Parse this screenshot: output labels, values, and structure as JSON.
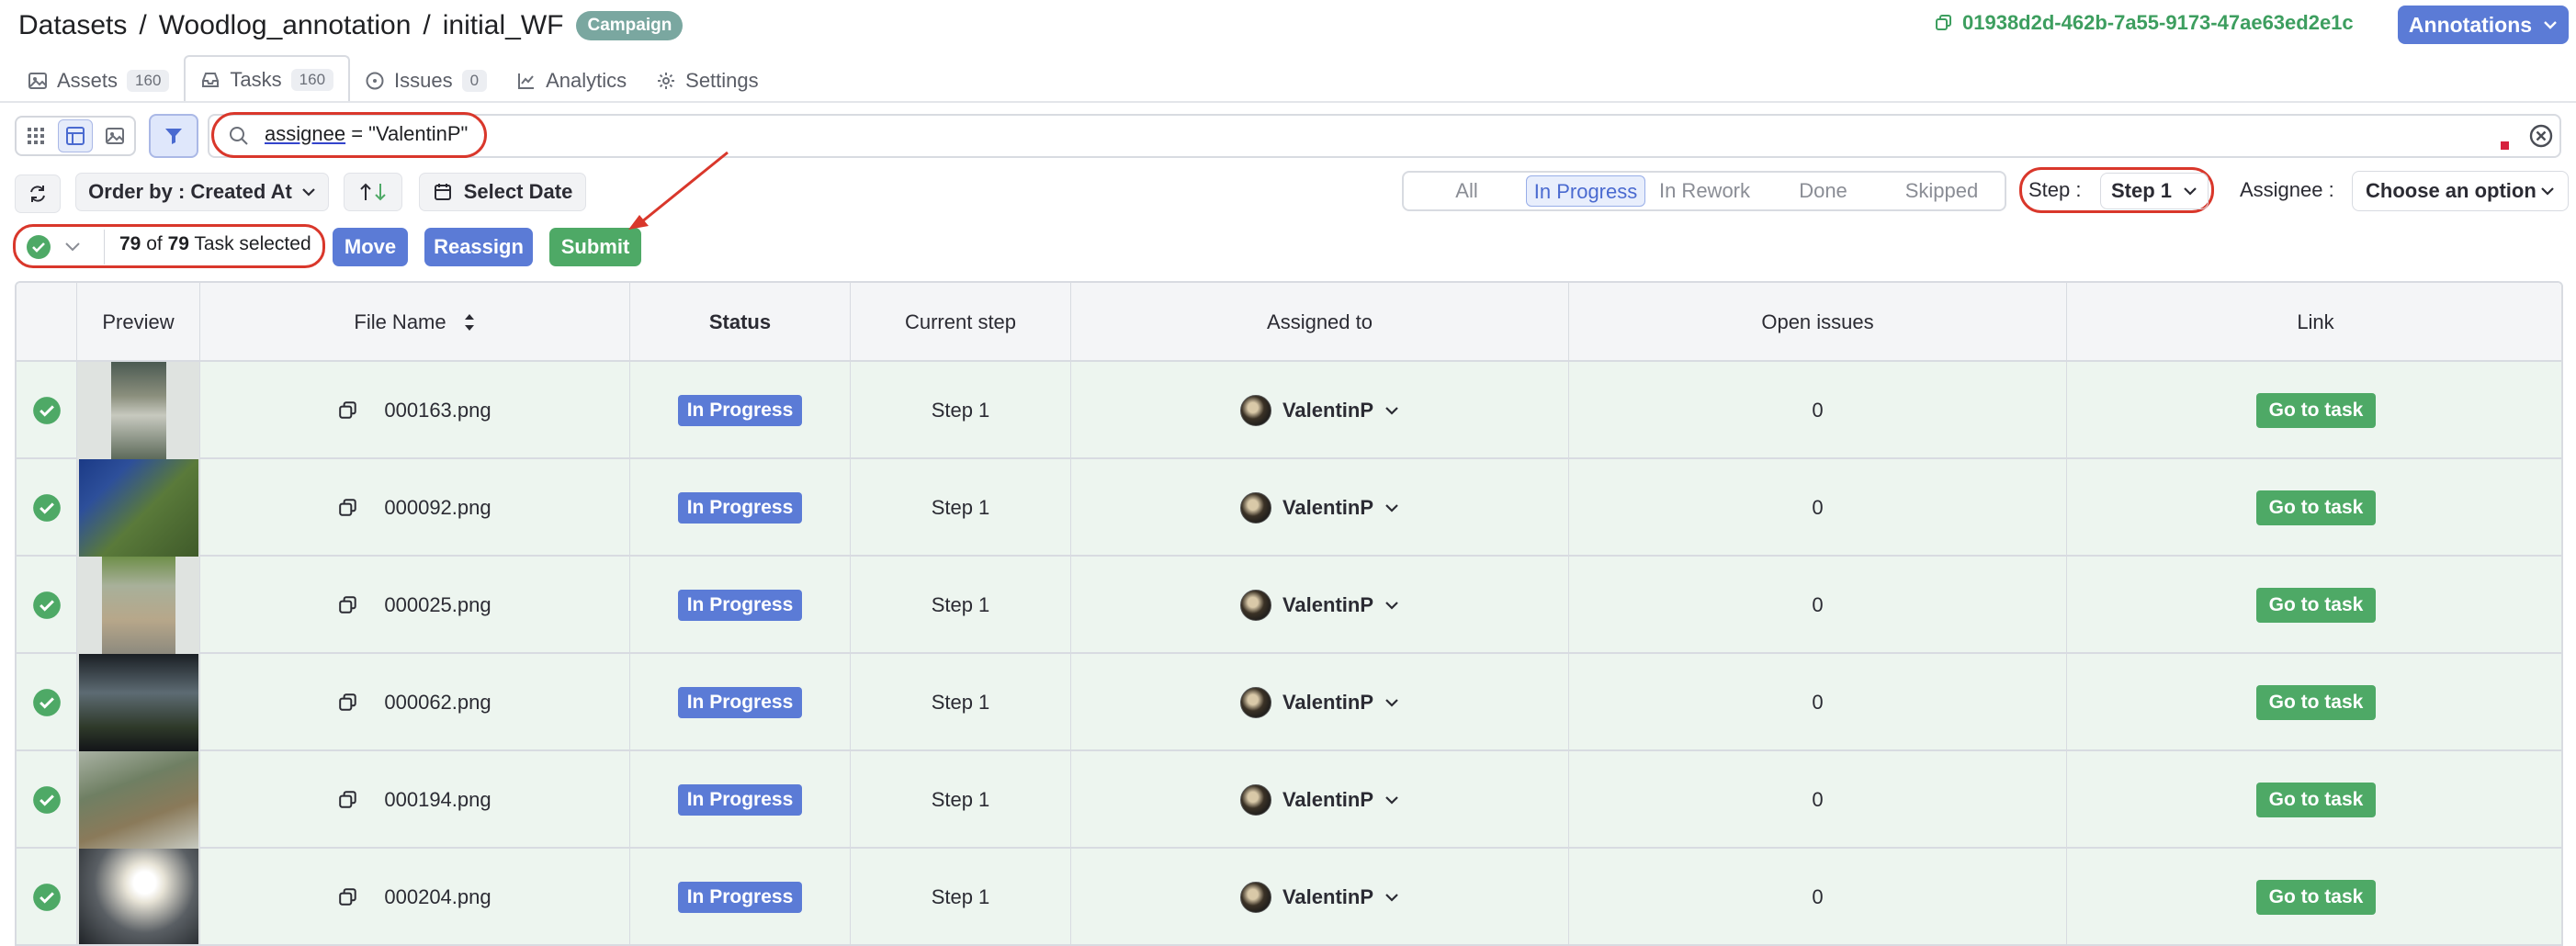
{
  "breadcrumb": {
    "part1": "Datasets",
    "part2": "Woodlog_annotation",
    "part3": "initial_WF",
    "separator": "/"
  },
  "campaign_badge": "Campaign",
  "dataset_id": "01938d2d-462b-7a55-9173-47ae63ed2e1c",
  "annotations_button": "Annotations",
  "tabs": [
    {
      "label": "Assets",
      "count": "160"
    },
    {
      "label": "Tasks",
      "count": "160"
    },
    {
      "label": "Issues",
      "count": "0"
    },
    {
      "label": "Analytics"
    },
    {
      "label": "Settings"
    }
  ],
  "search": {
    "key": "assignee",
    "rest": " = \"ValentinP\""
  },
  "controls": {
    "order_by": "Order by : Created At",
    "select_date": "Select Date",
    "status_filters": [
      "All",
      "In Progress",
      "In Rework",
      "Done",
      "Skipped"
    ],
    "active_status": "In Progress",
    "step_label": "Step :",
    "step_value": "Step 1",
    "assignee_label": "Assignee :",
    "assignee_placeholder": "Choose an option"
  },
  "selection": {
    "selected": "79",
    "of": "of",
    "total": "79",
    "suffix": "Task selected"
  },
  "actions": {
    "move": "Move",
    "reassign": "Reassign",
    "submit": "Submit"
  },
  "table": {
    "headers": {
      "preview": "Preview",
      "file_name": "File Name",
      "status": "Status",
      "current_step": "Current step",
      "assigned_to": "Assigned to",
      "open_issues": "Open issues",
      "link": "Link"
    },
    "rows": [
      {
        "file": "000163.png",
        "status": "In Progress",
        "step": "Step 1",
        "assignee": "ValentinP",
        "issues": "0",
        "link": "Go to task"
      },
      {
        "file": "000092.png",
        "status": "In Progress",
        "step": "Step 1",
        "assignee": "ValentinP",
        "issues": "0",
        "link": "Go to task"
      },
      {
        "file": "000025.png",
        "status": "In Progress",
        "step": "Step 1",
        "assignee": "ValentinP",
        "issues": "0",
        "link": "Go to task"
      },
      {
        "file": "000062.png",
        "status": "In Progress",
        "step": "Step 1",
        "assignee": "ValentinP",
        "issues": "0",
        "link": "Go to task"
      },
      {
        "file": "000194.png",
        "status": "In Progress",
        "step": "Step 1",
        "assignee": "ValentinP",
        "issues": "0",
        "link": "Go to task"
      },
      {
        "file": "000204.png",
        "status": "In Progress",
        "step": "Step 1",
        "assignee": "ValentinP",
        "issues": "0",
        "link": "Go to task"
      }
    ]
  },
  "colors": {
    "accent_blue": "#5b7bd6",
    "accent_green": "#4ea966",
    "row_bg": "#edf5ef",
    "highlight_red": "#d9372b"
  }
}
